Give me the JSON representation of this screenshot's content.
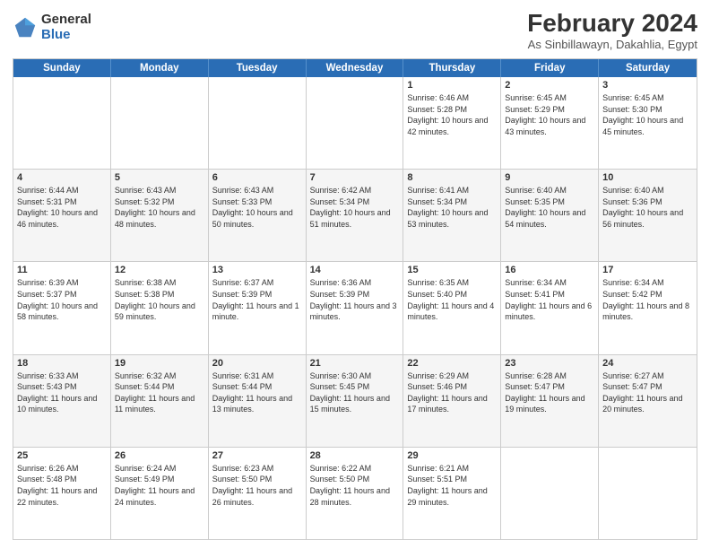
{
  "logo": {
    "general": "General",
    "blue": "Blue"
  },
  "title": "February 2024",
  "subtitle": "As Sinbillawayn, Dakahlia, Egypt",
  "days": [
    "Sunday",
    "Monday",
    "Tuesday",
    "Wednesday",
    "Thursday",
    "Friday",
    "Saturday"
  ],
  "weeks": [
    [
      {
        "day": "",
        "info": ""
      },
      {
        "day": "",
        "info": ""
      },
      {
        "day": "",
        "info": ""
      },
      {
        "day": "",
        "info": ""
      },
      {
        "day": "1",
        "info": "Sunrise: 6:46 AM\nSunset: 5:28 PM\nDaylight: 10 hours and 42 minutes."
      },
      {
        "day": "2",
        "info": "Sunrise: 6:45 AM\nSunset: 5:29 PM\nDaylight: 10 hours and 43 minutes."
      },
      {
        "day": "3",
        "info": "Sunrise: 6:45 AM\nSunset: 5:30 PM\nDaylight: 10 hours and 45 minutes."
      }
    ],
    [
      {
        "day": "4",
        "info": "Sunrise: 6:44 AM\nSunset: 5:31 PM\nDaylight: 10 hours and 46 minutes."
      },
      {
        "day": "5",
        "info": "Sunrise: 6:43 AM\nSunset: 5:32 PM\nDaylight: 10 hours and 48 minutes."
      },
      {
        "day": "6",
        "info": "Sunrise: 6:43 AM\nSunset: 5:33 PM\nDaylight: 10 hours and 50 minutes."
      },
      {
        "day": "7",
        "info": "Sunrise: 6:42 AM\nSunset: 5:34 PM\nDaylight: 10 hours and 51 minutes."
      },
      {
        "day": "8",
        "info": "Sunrise: 6:41 AM\nSunset: 5:34 PM\nDaylight: 10 hours and 53 minutes."
      },
      {
        "day": "9",
        "info": "Sunrise: 6:40 AM\nSunset: 5:35 PM\nDaylight: 10 hours and 54 minutes."
      },
      {
        "day": "10",
        "info": "Sunrise: 6:40 AM\nSunset: 5:36 PM\nDaylight: 10 hours and 56 minutes."
      }
    ],
    [
      {
        "day": "11",
        "info": "Sunrise: 6:39 AM\nSunset: 5:37 PM\nDaylight: 10 hours and 58 minutes."
      },
      {
        "day": "12",
        "info": "Sunrise: 6:38 AM\nSunset: 5:38 PM\nDaylight: 10 hours and 59 minutes."
      },
      {
        "day": "13",
        "info": "Sunrise: 6:37 AM\nSunset: 5:39 PM\nDaylight: 11 hours and 1 minute."
      },
      {
        "day": "14",
        "info": "Sunrise: 6:36 AM\nSunset: 5:39 PM\nDaylight: 11 hours and 3 minutes."
      },
      {
        "day": "15",
        "info": "Sunrise: 6:35 AM\nSunset: 5:40 PM\nDaylight: 11 hours and 4 minutes."
      },
      {
        "day": "16",
        "info": "Sunrise: 6:34 AM\nSunset: 5:41 PM\nDaylight: 11 hours and 6 minutes."
      },
      {
        "day": "17",
        "info": "Sunrise: 6:34 AM\nSunset: 5:42 PM\nDaylight: 11 hours and 8 minutes."
      }
    ],
    [
      {
        "day": "18",
        "info": "Sunrise: 6:33 AM\nSunset: 5:43 PM\nDaylight: 11 hours and 10 minutes."
      },
      {
        "day": "19",
        "info": "Sunrise: 6:32 AM\nSunset: 5:44 PM\nDaylight: 11 hours and 11 minutes."
      },
      {
        "day": "20",
        "info": "Sunrise: 6:31 AM\nSunset: 5:44 PM\nDaylight: 11 hours and 13 minutes."
      },
      {
        "day": "21",
        "info": "Sunrise: 6:30 AM\nSunset: 5:45 PM\nDaylight: 11 hours and 15 minutes."
      },
      {
        "day": "22",
        "info": "Sunrise: 6:29 AM\nSunset: 5:46 PM\nDaylight: 11 hours and 17 minutes."
      },
      {
        "day": "23",
        "info": "Sunrise: 6:28 AM\nSunset: 5:47 PM\nDaylight: 11 hours and 19 minutes."
      },
      {
        "day": "24",
        "info": "Sunrise: 6:27 AM\nSunset: 5:47 PM\nDaylight: 11 hours and 20 minutes."
      }
    ],
    [
      {
        "day": "25",
        "info": "Sunrise: 6:26 AM\nSunset: 5:48 PM\nDaylight: 11 hours and 22 minutes."
      },
      {
        "day": "26",
        "info": "Sunrise: 6:24 AM\nSunset: 5:49 PM\nDaylight: 11 hours and 24 minutes."
      },
      {
        "day": "27",
        "info": "Sunrise: 6:23 AM\nSunset: 5:50 PM\nDaylight: 11 hours and 26 minutes."
      },
      {
        "day": "28",
        "info": "Sunrise: 6:22 AM\nSunset: 5:50 PM\nDaylight: 11 hours and 28 minutes."
      },
      {
        "day": "29",
        "info": "Sunrise: 6:21 AM\nSunset: 5:51 PM\nDaylight: 11 hours and 29 minutes."
      },
      {
        "day": "",
        "info": ""
      },
      {
        "day": "",
        "info": ""
      }
    ]
  ]
}
